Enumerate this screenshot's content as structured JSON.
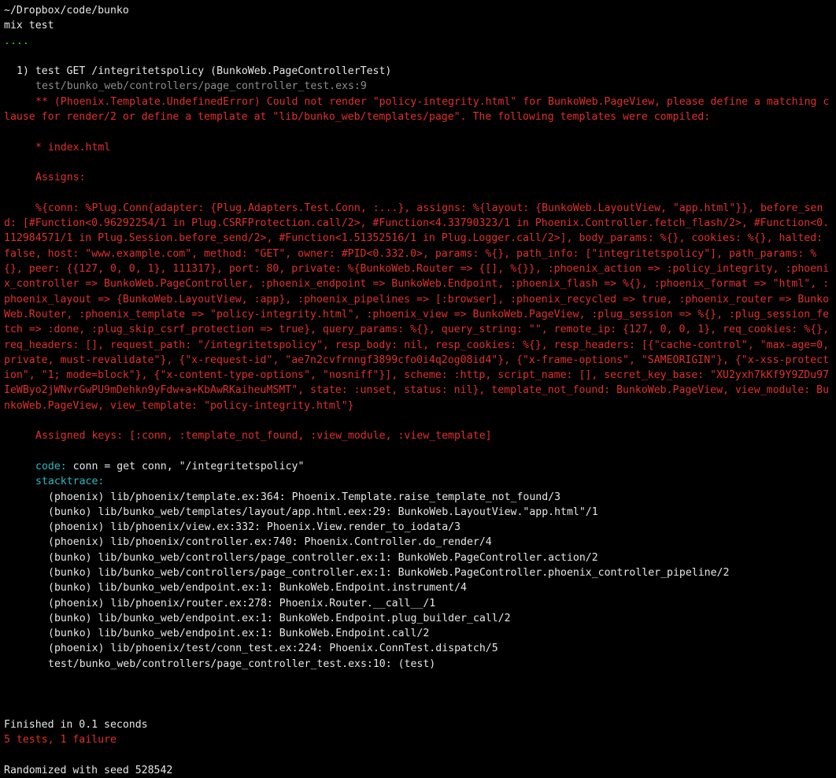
{
  "terminal": {
    "cwd": "~/Dropbox/code/bunko",
    "command": "mix test",
    "dots": "....",
    "failure": {
      "header": "1) test GET /integritetspolicy (BunkoWeb.PageControllerTest)",
      "location": "test/bunko_web/controllers/page_controller_test.exs:9",
      "error": "** (Phoenix.Template.UndefinedError) Could not render \"policy-integrity.html\" for BunkoWeb.PageView, please define a matching clause for render/2 or define a template at \"lib/bunko_web/templates/page\". The following templates were compiled:",
      "template_item": "* index.html",
      "assigns_label": "Assigns:",
      "assigns_body": "%{conn: %Plug.Conn{adapter: {Plug.Adapters.Test.Conn, :...}, assigns: %{layout: {BunkoWeb.LayoutView, \"app.html\"}}, before_send: [#Function<0.96292254/1 in Plug.CSRFProtection.call/2>, #Function<4.33790323/1 in Phoenix.Controller.fetch_flash/2>, #Function<0.112984571/1 in Plug.Session.before_send/2>, #Function<1.51352516/1 in Plug.Logger.call/2>], body_params: %{}, cookies: %{}, halted: false, host: \"www.example.com\", method: \"GET\", owner: #PID<0.332.0>, params: %{}, path_info: [\"integritetspolicy\"], path_params: %{}, peer: {{127, 0, 0, 1}, 111317}, port: 80, private: %{BunkoWeb.Router => {[], %{}}, :phoenix_action => :policy_integrity, :phoenix_controller => BunkoWeb.PageController, :phoenix_endpoint => BunkoWeb.Endpoint, :phoenix_flash => %{}, :phoenix_format => \"html\", :phoenix_layout => {BunkoWeb.LayoutView, :app}, :phoenix_pipelines => [:browser], :phoenix_recycled => true, :phoenix_router => BunkoWeb.Router, :phoenix_template => \"policy-integrity.html\", :phoenix_view => BunkoWeb.PageView, :plug_session => %{}, :plug_session_fetch => :done, :plug_skip_csrf_protection => true}, query_params: %{}, query_string: \"\", remote_ip: {127, 0, 0, 1}, req_cookies: %{}, req_headers: [], request_path: \"/integritetspolicy\", resp_body: nil, resp_cookies: %{}, resp_headers: [{\"cache-control\", \"max-age=0, private, must-revalidate\"}, {\"x-request-id\", \"ae7n2cvfrnngf3899cfo0i4q2og08id4\"}, {\"x-frame-options\", \"SAMEORIGIN\"}, {\"x-xss-protection\", \"1; mode=block\"}, {\"x-content-type-options\", \"nosniff\"}], scheme: :http, script_name: [], secret_key_base: \"XU2yxh7kKf9Y9ZDu97IeWByo2jWNvrGwPU9mDehkn9yFdw+a+KbAwRKaiheuMSMT\", state: :unset, status: nil}, template_not_found: BunkoWeb.PageView, view_module: BunkoWeb.PageView, view_template: \"policy-integrity.html\"}",
      "assigned_keys": "Assigned keys: [:conn, :template_not_found, :view_module, :view_template]",
      "code_label": "code:",
      "code_value": " conn = get conn, \"/integritetspolicy\"",
      "stacktrace_label": "stacktrace:",
      "stacktrace": [
        "(phoenix) lib/phoenix/template.ex:364: Phoenix.Template.raise_template_not_found/3",
        "(bunko) lib/bunko_web/templates/layout/app.html.eex:29: BunkoWeb.LayoutView.\"app.html\"/1",
        "(phoenix) lib/phoenix/view.ex:332: Phoenix.View.render_to_iodata/3",
        "(phoenix) lib/phoenix/controller.ex:740: Phoenix.Controller.do_render/4",
        "(bunko) lib/bunko_web/controllers/page_controller.ex:1: BunkoWeb.PageController.action/2",
        "(bunko) lib/bunko_web/controllers/page_controller.ex:1: BunkoWeb.PageController.phoenix_controller_pipeline/2",
        "(bunko) lib/bunko_web/endpoint.ex:1: BunkoWeb.Endpoint.instrument/4",
        "(phoenix) lib/phoenix/router.ex:278: Phoenix.Router.__call__/1",
        "(bunko) lib/bunko_web/endpoint.ex:1: BunkoWeb.Endpoint.plug_builder_call/2",
        "(bunko) lib/bunko_web/endpoint.ex:1: BunkoWeb.Endpoint.call/2",
        "(phoenix) lib/phoenix/test/conn_test.ex:224: Phoenix.ConnTest.dispatch/5",
        "test/bunko_web/controllers/page_controller_test.exs:10: (test)"
      ]
    },
    "finished": "Finished in 0.1 seconds",
    "summary": "5 tests, 1 failure",
    "seed": "Randomized with seed 528542"
  },
  "colors": {
    "background": "#000000",
    "text": "#e6e6e6",
    "pass": "#33c433",
    "error": "#e0302b",
    "muted": "#8c8c8c",
    "accent": "#2bb8c6"
  }
}
